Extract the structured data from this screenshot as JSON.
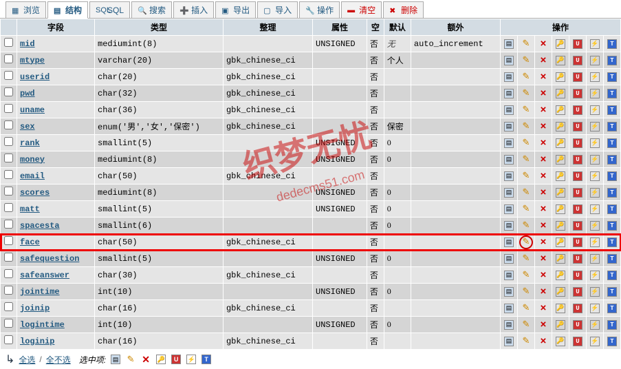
{
  "tabs": [
    {
      "label": "浏览",
      "active": false
    },
    {
      "label": "结构",
      "active": true
    },
    {
      "label": "SQL",
      "active": false
    },
    {
      "label": "搜索",
      "active": false
    },
    {
      "label": "插入",
      "active": false
    },
    {
      "label": "导出",
      "active": false
    },
    {
      "label": "导入",
      "active": false
    },
    {
      "label": "操作",
      "active": false
    },
    {
      "label": "清空",
      "active": false,
      "danger": true
    },
    {
      "label": "删除",
      "active": false,
      "danger": true
    }
  ],
  "headers": {
    "field": "字段",
    "type": "类型",
    "collation": "整理",
    "attributes": "属性",
    "null": "空",
    "default": "默认",
    "extra": "额外",
    "action": "操作"
  },
  "rows": [
    {
      "field": "mid",
      "type": "mediumint(8)",
      "collation": "",
      "attr": "UNSIGNED",
      "null": "否",
      "default": "无",
      "default_italic": true,
      "extra": "auto_increment",
      "hl": false
    },
    {
      "field": "mtype",
      "type": "varchar(20)",
      "collation": "gbk_chinese_ci",
      "attr": "",
      "null": "否",
      "default": "个人",
      "extra": "",
      "hl": false
    },
    {
      "field": "userid",
      "type": "char(20)",
      "collation": "gbk_chinese_ci",
      "attr": "",
      "null": "否",
      "default": "",
      "extra": "",
      "hl": false
    },
    {
      "field": "pwd",
      "type": "char(32)",
      "collation": "gbk_chinese_ci",
      "attr": "",
      "null": "否",
      "default": "",
      "extra": "",
      "hl": false
    },
    {
      "field": "uname",
      "type": "char(36)",
      "collation": "gbk_chinese_ci",
      "attr": "",
      "null": "否",
      "default": "",
      "extra": "",
      "hl": false
    },
    {
      "field": "sex",
      "type": "enum('男','女','保密')",
      "collation": "gbk_chinese_ci",
      "attr": "",
      "null": "否",
      "default": "保密",
      "extra": "",
      "hl": false
    },
    {
      "field": "rank",
      "type": "smallint(5)",
      "collation": "",
      "attr": "UNSIGNED",
      "null": "否",
      "default": "0",
      "extra": "",
      "hl": false
    },
    {
      "field": "money",
      "type": "mediumint(8)",
      "collation": "",
      "attr": "UNSIGNED",
      "null": "否",
      "default": "0",
      "extra": "",
      "hl": false
    },
    {
      "field": "email",
      "type": "char(50)",
      "collation": "gbk_chinese_ci",
      "attr": "",
      "null": "否",
      "default": "",
      "extra": "",
      "hl": false
    },
    {
      "field": "scores",
      "type": "mediumint(8)",
      "collation": "",
      "attr": "UNSIGNED",
      "null": "否",
      "default": "0",
      "extra": "",
      "hl": false
    },
    {
      "field": "matt",
      "type": "smallint(5)",
      "collation": "",
      "attr": "UNSIGNED",
      "null": "否",
      "default": "0",
      "extra": "",
      "hl": false
    },
    {
      "field": "spacesta",
      "type": "smallint(6)",
      "collation": "",
      "attr": "",
      "null": "否",
      "default": "0",
      "extra": "",
      "hl": false
    },
    {
      "field": "face",
      "type": "char(50)",
      "collation": "gbk_chinese_ci",
      "attr": "",
      "null": "否",
      "default": "",
      "extra": "",
      "hl": true
    },
    {
      "field": "safequestion",
      "type": "smallint(5)",
      "collation": "",
      "attr": "UNSIGNED",
      "null": "否",
      "default": "0",
      "extra": "",
      "hl": false
    },
    {
      "field": "safeanswer",
      "type": "char(30)",
      "collation": "gbk_chinese_ci",
      "attr": "",
      "null": "否",
      "default": "",
      "extra": "",
      "hl": false
    },
    {
      "field": "jointime",
      "type": "int(10)",
      "collation": "",
      "attr": "UNSIGNED",
      "null": "否",
      "default": "0",
      "extra": "",
      "hl": false
    },
    {
      "field": "joinip",
      "type": "char(16)",
      "collation": "gbk_chinese_ci",
      "attr": "",
      "null": "否",
      "default": "",
      "extra": "",
      "hl": false
    },
    {
      "field": "logintime",
      "type": "int(10)",
      "collation": "",
      "attr": "UNSIGNED",
      "null": "否",
      "default": "0",
      "extra": "",
      "hl": false
    },
    {
      "field": "loginip",
      "type": "char(16)",
      "collation": "gbk_chinese_ci",
      "attr": "",
      "null": "否",
      "default": "",
      "extra": "",
      "hl": false
    }
  ],
  "footer": {
    "check_all": "全选",
    "uncheck_all": "全不选",
    "with_selected": "选中项:"
  },
  "watermark": {
    "main": "织梦无忧",
    "sub": "dedecms51.com"
  }
}
